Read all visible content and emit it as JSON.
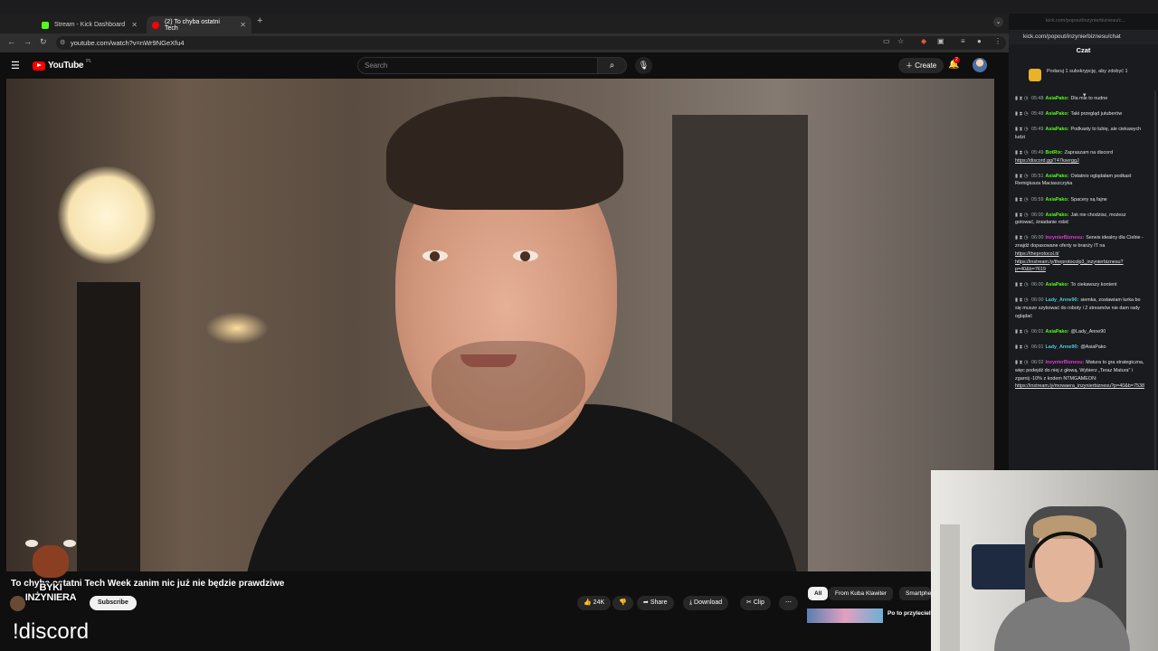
{
  "browser": {
    "tabs": [
      {
        "label": "Stream - Kick Dashboard",
        "active": false
      },
      {
        "label": "(2) To chyba ostatni Tech",
        "active": true
      }
    ],
    "url": "youtube.com/watch?v=nWr9NGeXfu4"
  },
  "youtube": {
    "logo_text": "YouTube",
    "region": "PL",
    "search_placeholder": "Search",
    "create_label": "Create",
    "notification_count": "2",
    "video_title": "To chyba ostatni Tech Week zanim nic już nie będzie prawdziwe",
    "subscribe_label": "Subscribe",
    "likes": "24K",
    "share_label": "Share",
    "download_label": "Download",
    "clip_label": "Clip",
    "chips": [
      "All",
      "From Kuba Klawiter",
      "Smartphe"
    ],
    "rec_title": "Po to przylecieli"
  },
  "overlay": {
    "logo_line1": "BYKI",
    "logo_line2": "INŻYNIERA",
    "command": "!discord"
  },
  "chat": {
    "dim_tab": "kick.com/popout/inzynierbiznesu/c...",
    "url": "kick.com/popout/inzynierbiznesu/chat",
    "title": "Czat",
    "promo": "Podaruj 1 subskrypcję, aby zdobyć 1",
    "messages": [
      {
        "time": "05:48",
        "user": "AsiaPako",
        "color": "#53fc18",
        "text": "Dla mie to nudne"
      },
      {
        "time": "05:48",
        "user": "AsiaPako",
        "color": "#53fc18",
        "text": "Taki przegląd jutuberów"
      },
      {
        "time": "05:49",
        "user": "AsiaPako",
        "color": "#53fc18",
        "text": "Podkasty to lubię, ale ciekawych ludzi"
      },
      {
        "time": "05:49",
        "user": "BotRix",
        "color": "#53fc18",
        "text": "Zapraszam na discord",
        "link": "https://discord.gg/T47kserggJ"
      },
      {
        "time": "05:51",
        "user": "AsiaPako",
        "color": "#53fc18",
        "text": "Ostatnio oglądałam podkast Remigiusza Maciaszczyka"
      },
      {
        "time": "05:59",
        "user": "AsiaPako",
        "color": "#53fc18",
        "text": "Spacery są fajne"
      },
      {
        "time": "06:00",
        "user": "AsiaPako",
        "color": "#53fc18",
        "text": "Jak nie chodzisz, możesz gotować, śniadanie robić"
      },
      {
        "time": "06:00",
        "user": "InzynierBiznesu",
        "color": "#e13bd3",
        "text": "Serwis idealny dla Ciebie - znajdź dopasowane oferty w branży IT na",
        "link": "https://theprotocol.it/ https://instream.ly/theprotocolp3_inzynierbiznesu?p=40&b=7619"
      },
      {
        "time": "06:00",
        "user": "AsiaPako",
        "color": "#53fc18",
        "text": "To ciekawszy kontent"
      },
      {
        "time": "06:00",
        "user": "Lady_Anne90",
        "color": "#4ec9d8",
        "text": "siemka, zostawiam lurka bo się musze szykować do roboty i 2 streamów nie dam rady oglądać"
      },
      {
        "time": "06:01",
        "user": "AsiaPako",
        "color": "#53fc18",
        "text": "@Lady_Anne90"
      },
      {
        "time": "06:01",
        "user": "Lady_Anne90",
        "color": "#4ec9d8",
        "text": "@AsiaPako"
      },
      {
        "time": "06:02",
        "user": "InzynierBiznesu",
        "color": "#e13bd3",
        "text": "Matura to gra strategiczna, więc podejdź do niej z głową. Wybierz „Teraz Matura” i zgarnij -10% z kodem NTMGAMEON:",
        "link": "https://instream.ly/mowaera_inzynierbiznesu?p=40&b=7538"
      }
    ]
  },
  "colors": {
    "yt_red": "#ff0000",
    "kick_green": "#53fc18",
    "chat_bg": "#191b1f"
  }
}
